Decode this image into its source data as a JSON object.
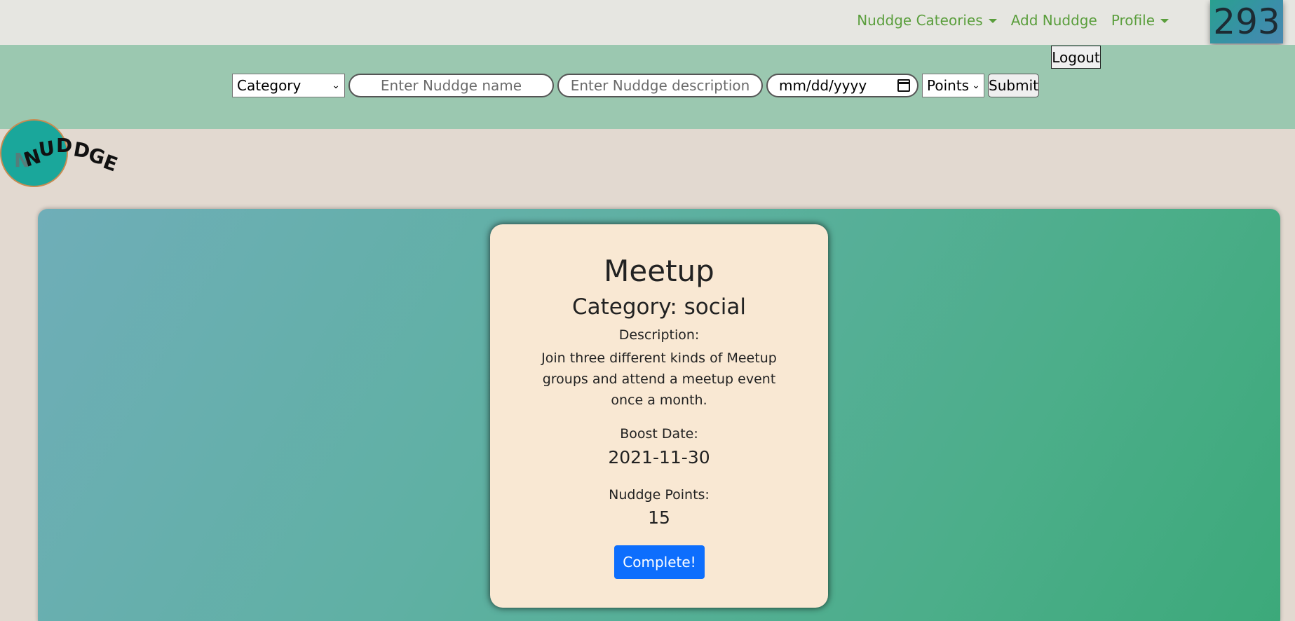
{
  "navbar": {
    "links": [
      {
        "label": "Nuddge Cateories",
        "dropdown": true
      },
      {
        "label": "Add Nuddge",
        "dropdown": false
      },
      {
        "label": "Profile",
        "dropdown": true
      }
    ],
    "points_total": "293",
    "link_color": "#5a9e3c"
  },
  "form": {
    "logout_label": "Logout",
    "category_select": "Category",
    "name_placeholder": "Enter Nuddge name",
    "description_placeholder": "Enter Nuddge description",
    "date_placeholder": "mm/dd/yyyy",
    "points_select": "Points",
    "submit_label": "Submit",
    "band_color": "#9bc8b0"
  },
  "logo": {
    "text": "NUDDGE",
    "circle_color": "#1aa79b"
  },
  "card": {
    "title": "Meetup",
    "category": "Category: social",
    "description_label": "Description:",
    "description": "Join three different kinds of Meetup groups and attend a meetup event once a month.",
    "boost_label": "Boost Date:",
    "boost_date": "2021-11-30",
    "points_label": "Nuddge Points:",
    "points": "15",
    "complete_label": "Complete!",
    "complete_color": "#0d6efd"
  }
}
